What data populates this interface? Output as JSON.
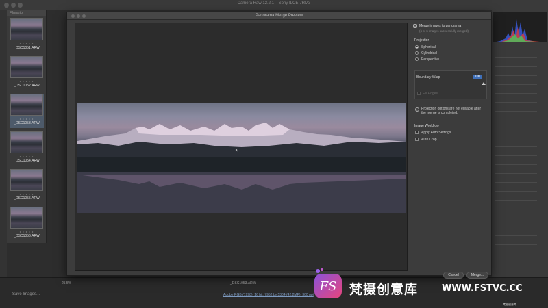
{
  "app": {
    "title": "Camera Raw 12.2.1  –  Sony ILCE-7RM3"
  },
  "filmstrip": {
    "header": "Filmstrip",
    "items": [
      {
        "name": "_DSC1051.ARW",
        "stars": "• • • • •",
        "selected": false
      },
      {
        "name": "_DSC1052.ARW",
        "stars": "• • • • •",
        "selected": false
      },
      {
        "name": "_DSC1053.ARW",
        "stars": "• • • • •",
        "selected": true
      },
      {
        "name": "_DSC1054.ARW",
        "stars": "• • • • •",
        "selected": false
      },
      {
        "name": "_DSC1055.ARW",
        "stars": "• • • • •",
        "selected": false
      },
      {
        "name": "_DSC1056.ARW",
        "stars": "• • • • •",
        "selected": false
      }
    ]
  },
  "status": {
    "zoom": "25.5%",
    "filename": "_DSC1053.ARW",
    "save_images": "Save Images...",
    "workflow": "Adobe RGB (1998); 16 bit; 7952 by 5304 (42.2MP); 300 ppi"
  },
  "dialog": {
    "title": "Panorama Merge Preview",
    "merge_header": "Merge images to panorama",
    "merge_sub": "(6 of 6 images successfully merged)",
    "projection_title": "Projection",
    "projections": [
      {
        "label": "Spherical",
        "selected": true
      },
      {
        "label": "Cylindrical",
        "selected": false
      },
      {
        "label": "Perspective",
        "selected": false
      }
    ],
    "boundary_warp_label": "Boundary Warp",
    "boundary_warp_value": "100",
    "fill_edges_label": "Fill Edges",
    "projection_note": "Projection options are not editable after the merge is completed.",
    "image_workflow_title": "Image Workflow",
    "apply_auto_label": "Apply Auto Settings",
    "auto_crop_label": "Auto Crop",
    "cancel_label": "Cancel",
    "merge_label": "Merge..."
  },
  "watermark": {
    "logo_letters": "FS",
    "text": "梵摄创意库",
    "url": "WWW.FSTVC.CC",
    "badge": "梵摄创意库"
  },
  "colors": {
    "accent_blue": "#3f6fb8",
    "watermark_pink": "#e8457c",
    "watermark_purple": "#8a52d8"
  }
}
